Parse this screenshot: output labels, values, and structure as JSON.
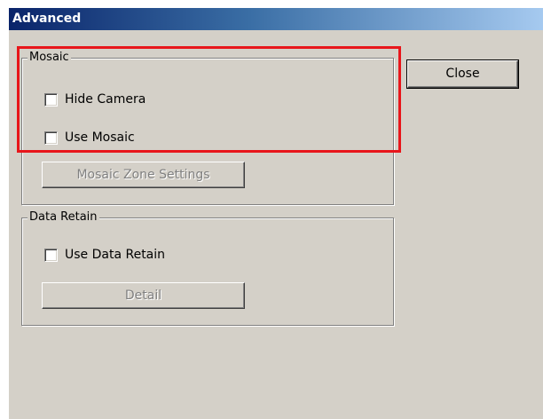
{
  "window": {
    "title": "Advanced"
  },
  "mosaic_group": {
    "label": "Mosaic",
    "hide_camera": {
      "label": "Hide Camera",
      "checked": false
    },
    "use_mosaic": {
      "label": "Use Mosaic",
      "checked": false
    },
    "zone_settings_button": {
      "label": "Mosaic Zone Settings",
      "enabled": false
    }
  },
  "data_retain_group": {
    "label": "Data Retain",
    "use_data_retain": {
      "label": "Use Data Retain",
      "checked": false
    },
    "detail_button": {
      "label": "Detail",
      "enabled": false
    }
  },
  "close_button": {
    "label": "Close"
  },
  "annotation": {
    "color": "#e8161b"
  }
}
